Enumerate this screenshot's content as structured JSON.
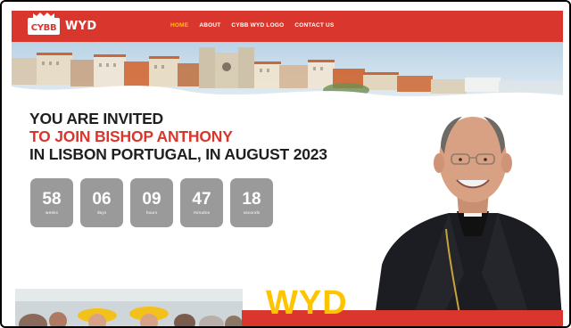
{
  "brand": {
    "logo_mark": "CYBB",
    "logo_text": "WYD"
  },
  "nav": {
    "items": [
      {
        "label": "HOME",
        "active": true
      },
      {
        "label": "ABOUT",
        "active": false
      },
      {
        "label": "CYBB WYD LOGO",
        "active": false
      },
      {
        "label": "CONTACT US",
        "active": false
      }
    ]
  },
  "hero": {
    "line1": "YOU ARE INVITED",
    "line2": "TO JOIN BISHOP ANTHONY",
    "line3": "IN LISBON PORTUGAL, IN AUGUST 2023"
  },
  "countdown": [
    {
      "value": "58",
      "unit": "weeks"
    },
    {
      "value": "06",
      "unit": "days"
    },
    {
      "value": "09",
      "unit": "hours"
    },
    {
      "value": "47",
      "unit": "minutes"
    },
    {
      "value": "18",
      "unit": "seconds"
    }
  ],
  "footer_banner": {
    "word": "WYD"
  },
  "colors": {
    "brand_red": "#d9372d",
    "accent_yellow": "#ffc400",
    "countdown_gray": "#9a9a9a",
    "text_dark": "#1f1f1f"
  }
}
